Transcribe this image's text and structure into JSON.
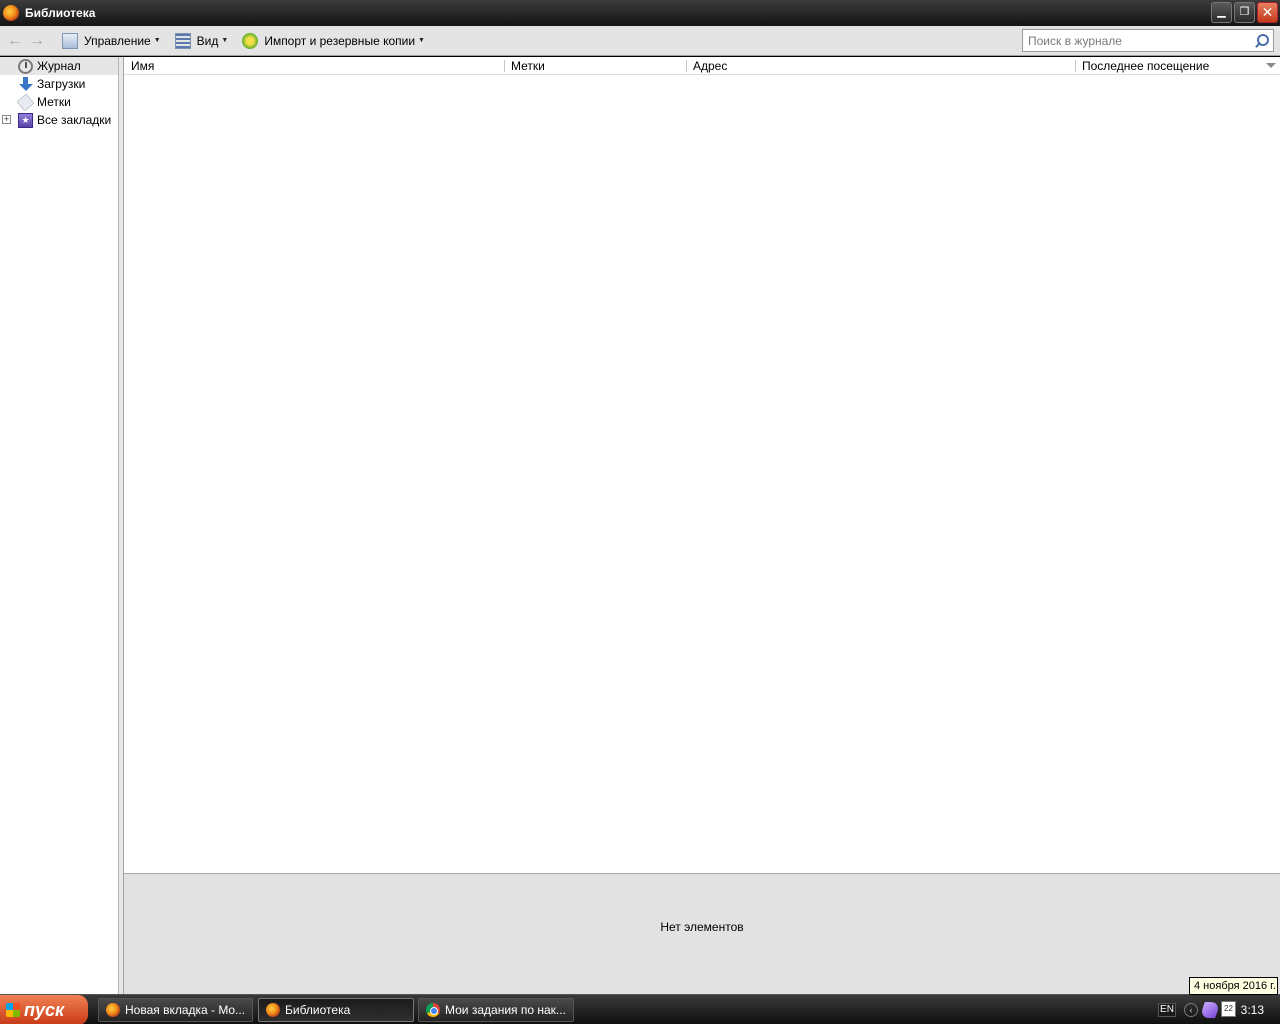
{
  "window": {
    "title": "Библиотека"
  },
  "toolbar": {
    "back_label": "←",
    "forward_label": "→",
    "organize_label": "Управление",
    "view_label": "Вид",
    "import_label": "Импорт и резервные копии",
    "search_placeholder": "Поиск в журнале",
    "search_value": ""
  },
  "sidebar": {
    "items": [
      {
        "label": "Журнал",
        "icon": "history-icon",
        "selected": true
      },
      {
        "label": "Загрузки",
        "icon": "downloads-icon"
      },
      {
        "label": "Метки",
        "icon": "tags-icon"
      },
      {
        "label": "Все закладки",
        "icon": "bookmarks-icon",
        "expandable": true
      }
    ]
  },
  "table": {
    "columns": [
      "Имя",
      "Метки",
      "Адрес",
      "Последнее посещение"
    ],
    "rows": []
  },
  "details": {
    "empty_text": "Нет элементов"
  },
  "taskbar": {
    "start_label": "пуск",
    "tasks": [
      {
        "label": "Новая вкладка - Mo...",
        "icon": "firefox-icon"
      },
      {
        "label": "Библиотека",
        "icon": "firefox-icon",
        "active": true
      },
      {
        "label": "Мои задания по нак...",
        "icon": "chrome-icon"
      }
    ],
    "language": "EN",
    "calendar_day": "22",
    "clock": "3:13",
    "date_tooltip": "4 ноября 2016 г."
  }
}
